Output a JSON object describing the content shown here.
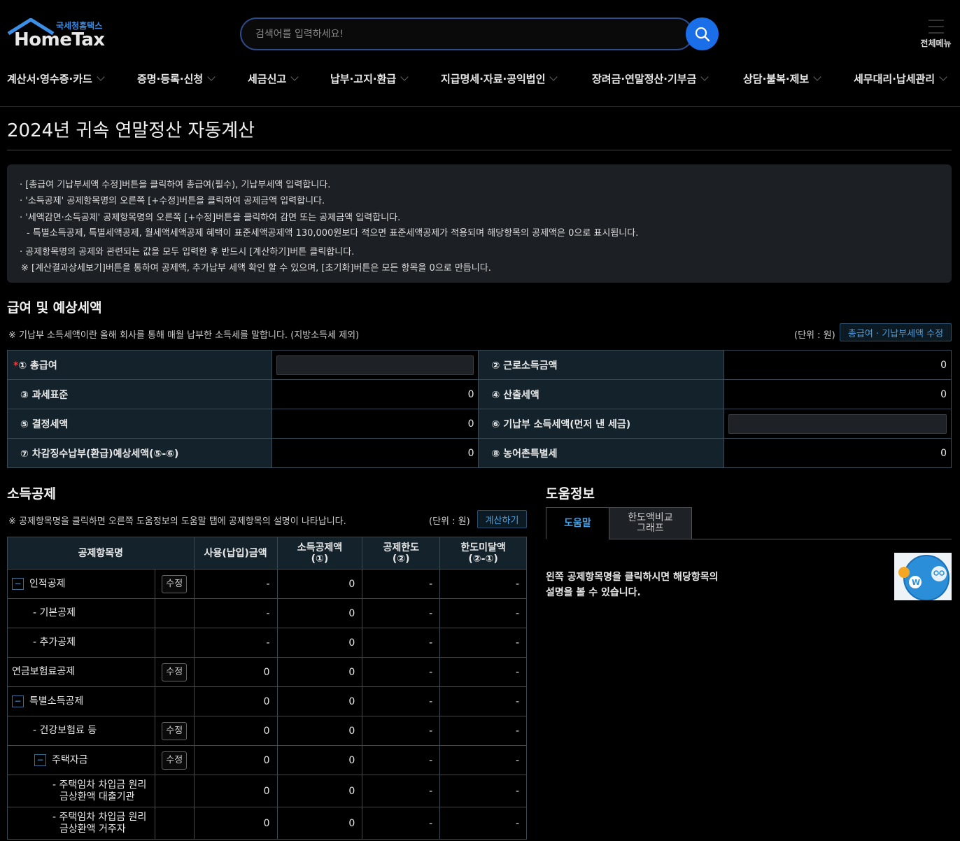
{
  "header": {
    "logo_small": "국세청홈택스",
    "logo_big": "HomeTax",
    "search_placeholder": "검색어를 입력하세요!",
    "all_menu": "전체메뉴"
  },
  "nav": [
    "계산서·영수증·카드",
    "증명·등록·신청",
    "세금신고",
    "납부·고지·환급",
    "지급명세·자료·공익법인",
    "장려금·연말정산·기부금",
    "상담·불복·제보",
    "세무대리·납세관리"
  ],
  "page_title": "2024년 귀속 연말정산 자동계산",
  "info_lines": [
    "· [총급여 기납부세액 수정]버튼을 클릭하여 총급여(필수), 기납부세액 입력합니다.",
    "· '소득공제' 공제항목명의 오른쪽 [+수정]버튼을 클릭하여 공제금액 입력합니다.",
    "· '세액감면·소득공제' 공제항목명의 오른쪽 [+수정]버튼을 클릭하여 감면 또는 공제금액 입력합니다.",
    "- 특별소득공제, 특별세액공제, 월세액세액공제 혜택이 표준세액공제액 130,000원보다 적으면 표준세액공제가 적용되며 해당항목의 공제액은 0으로 표시됩니다.",
    "· 공제항목명의 공제와 관련되는 값을 모두 입력한 후 반드시 [계산하기]버튼 클릭합니다.",
    "※ [계산결과상세보기]버튼을 통하여 공제액, 추가납부 세액 확인 할 수 있으며, [초기화]버튼은 모든 항목을 0으로 만듭니다."
  ],
  "salary": {
    "title": "급여 및 예상세액",
    "note": "※ 기납부 소득세액이란 올해 회사를 통해 매월 납부한 소득세를 말합니다. (지방소득세 제외)",
    "unit": "(단위 : 원)",
    "edit_button": "총급여 · 기납부세액 수정",
    "required_mark": "*",
    "rows": [
      {
        "l1": "① 총급여",
        "v1": "",
        "l2": "② 근로소득금액",
        "v2": "0"
      },
      {
        "l1": "③ 과세표준",
        "v1": "0",
        "l2": "④ 산출세액",
        "v2": "0"
      },
      {
        "l1": "⑤ 결정세액",
        "v1": "0",
        "l2": "⑥ 기납부 소득세액(먼저 낸 세금)",
        "v2": ""
      },
      {
        "l1": "⑦ 차감징수납부(환급)예상세액(⑤-⑥)",
        "v1": "0",
        "l2": "⑧ 농어촌특별세",
        "v2": "0"
      }
    ]
  },
  "deduction": {
    "title": "소득공제",
    "note": "※ 공제항목명을 클릭하면 오른쪽 도움정보의 도움말 탭에 공제항목의 설명이 나타납니다.",
    "unit": "(단위 : 원)",
    "calc_button": "계산하기",
    "headers": [
      "공제항목명",
      "사용(납입)금액",
      "소득공제액\n(①)",
      "공제한도\n(②)",
      "한도미달액\n(②-①)"
    ],
    "edit_label": "수정",
    "minus_label": "−",
    "rows": [
      {
        "name": "인적공제",
        "amount": "-",
        "deduct": "0",
        "limit": "-",
        "short": "-"
      },
      {
        "name": "- 기본공제",
        "amount": "-",
        "deduct": "0",
        "limit": "-",
        "short": "-"
      },
      {
        "name": "- 추가공제",
        "amount": "-",
        "deduct": "0",
        "limit": "-",
        "short": "-"
      },
      {
        "name": "연금보험료공제",
        "amount": "0",
        "deduct": "0",
        "limit": "-",
        "short": "-"
      },
      {
        "name": "특별소득공제",
        "amount": "0",
        "deduct": "0",
        "limit": "-",
        "short": "-"
      },
      {
        "name": "- 건강보험료 등",
        "amount": "0",
        "deduct": "0",
        "limit": "-",
        "short": "-"
      },
      {
        "name": "주택자금",
        "amount": "0",
        "deduct": "0",
        "limit": "-",
        "short": "-"
      },
      {
        "name_l1": "- 주택임차 차입금 원리",
        "name_l2": "금상환액 대출기관",
        "amount": "0",
        "deduct": "0",
        "limit": "-",
        "short": "-"
      },
      {
        "name_l1": "- 주택임차 차입금 원리",
        "name_l2": "금상환액 거주자",
        "amount": "0",
        "deduct": "0",
        "limit": "-",
        "short": "-"
      }
    ]
  },
  "help": {
    "title": "도움정보",
    "tab_active": "도움말",
    "tab_inactive_l1": "한도액비교",
    "tab_inactive_l2": "그래프",
    "text_l1": "왼쪽 공제항목명을 클릭하시면 해당항목의",
    "text_l2": "설명을 볼 수 있습니다."
  },
  "colors": {
    "accent": "#1a6ee8",
    "link": "#4aa0e0",
    "label_bg": "#14232b",
    "required": "#e04040"
  }
}
